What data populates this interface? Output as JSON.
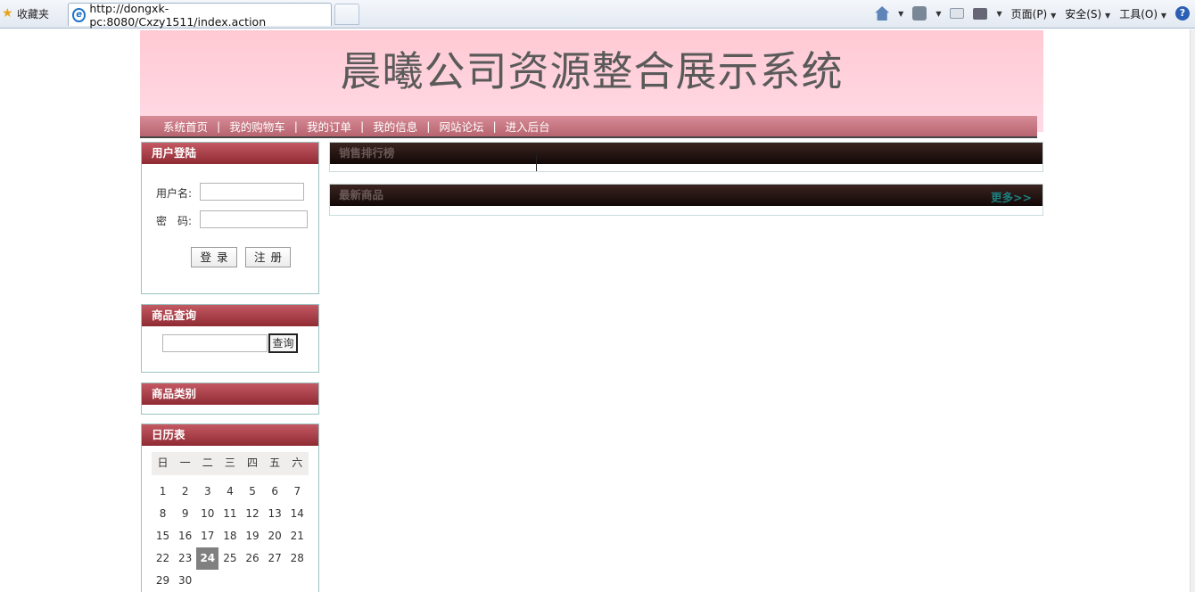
{
  "browser": {
    "favorites_label": "收藏夹",
    "tab_url": "http://dongxk-pc:8080/Cxzy1511/index.action",
    "menu_page": "页面(P)",
    "menu_safety": "安全(S)",
    "menu_tools": "工具(O)"
  },
  "site": {
    "title": "晨曦公司资源整合展示系统",
    "nav": [
      "系统首页",
      "我的购物车",
      "我的订单",
      "我的信息",
      "网站论坛",
      "进入后台"
    ],
    "nav_separator": "|"
  },
  "login": {
    "title": "用户登陆",
    "username_label": "用户名:",
    "password_label": "密　码:",
    "login_button": "登录",
    "register_button": "注册"
  },
  "search": {
    "title": "商品查询",
    "button": "查询"
  },
  "categories": {
    "title": "商品类别"
  },
  "calendar": {
    "title": "日历表",
    "weekdays": [
      "日",
      "一",
      "二",
      "三",
      "四",
      "五",
      "六"
    ],
    "weeks": [
      [
        "1",
        "2",
        "3",
        "4",
        "5",
        "6",
        "7"
      ],
      [
        "8",
        "9",
        "10",
        "11",
        "12",
        "13",
        "14"
      ],
      [
        "15",
        "16",
        "17",
        "18",
        "19",
        "20",
        "21"
      ],
      [
        "22",
        "23",
        "24",
        "25",
        "26",
        "27",
        "28"
      ],
      [
        "29",
        "30",
        "",
        "",
        "",
        "",
        ""
      ]
    ],
    "today": "24"
  },
  "main": {
    "sales_title": "销售排行榜",
    "new_title": "最新商品",
    "more_label": "更多>>"
  }
}
